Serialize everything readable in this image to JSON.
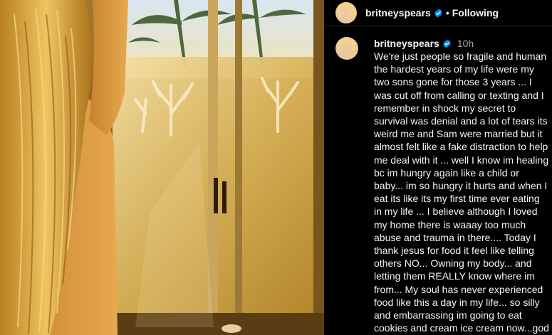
{
  "post": {
    "media": {
      "description_icon": "photo"
    },
    "header": {
      "username": "britneyspears",
      "separator": "•",
      "follow_status": "Following"
    },
    "comment": {
      "username": "britneyspears",
      "time": "10h",
      "caption": "We're just people so fragile and human the hardest years of my life were my two sons gone for those 3 years ... I was cut off from calling or texting and I remember in shock my secret to survival was denial and a lot of tears its weird me and Sam were married but it almost felt like a fake distraction to help me deal with it ... well I know im healing bc im hungry again like a child or baby... im so hungry it hurts and when I eat its like its my first time ever eating in my life ... I believe although I loved my home there is waaay too much abuse and trauma in there.... Today I thank jesus for food it feel like telling others NO... Owning my  body... and letting them REALLY know where im from... My soul has never experienced food like this a day in my life... so silly and embarrassing im going to eat cookies and cream ice cream now...god bless yall"
    }
  },
  "colors": {
    "background": "#000000",
    "text": "#f5f5f5",
    "secondary_text": "#a8a8a8",
    "verified_blue": "#0095f6",
    "divider": "#262626"
  }
}
